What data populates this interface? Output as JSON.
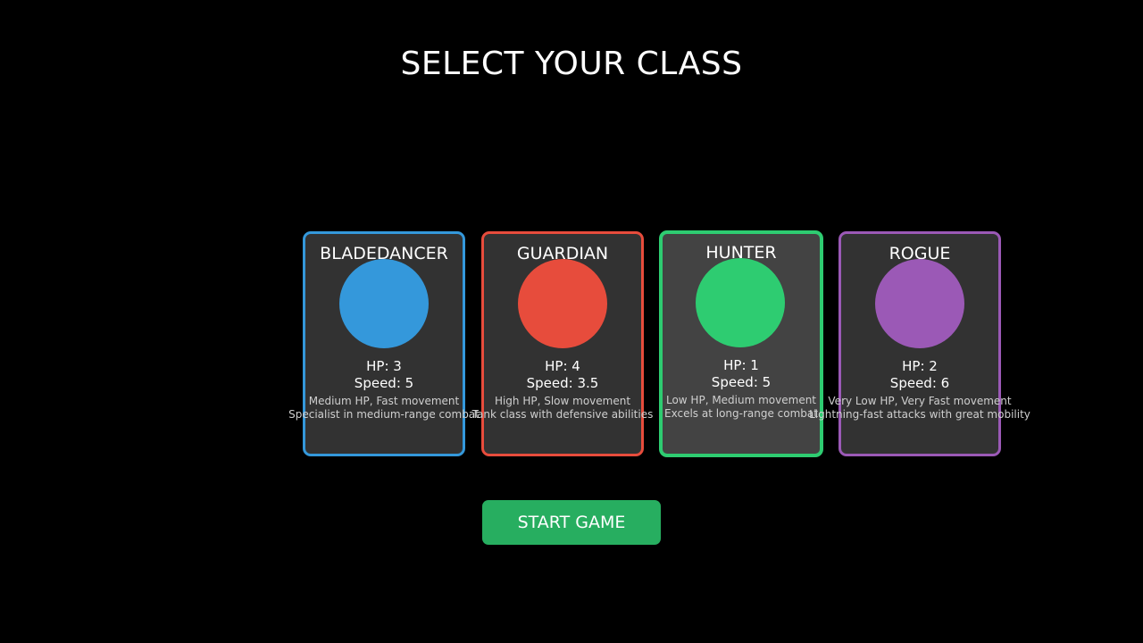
{
  "title": "SELECT YOUR CLASS",
  "selected_class": "HUNTER",
  "classes": [
    {
      "name": "BLADEDANCER",
      "color": "#3498db",
      "hp": "HP: 3",
      "speed": "Speed: 5",
      "desc1": "Medium HP, Fast movement",
      "desc2": "Specialist in medium-range combat"
    },
    {
      "name": "GUARDIAN",
      "color": "#e74c3c",
      "hp": "HP: 4",
      "speed": "Speed: 3.5",
      "desc1": "High HP, Slow movement",
      "desc2": "Tank class with defensive abilities"
    },
    {
      "name": "HUNTER",
      "color": "#2ecc71",
      "hp": "HP: 1",
      "speed": "Speed: 5",
      "desc1": "Low HP, Medium movement",
      "desc2": "Excels at long-range combat"
    },
    {
      "name": "ROGUE",
      "color": "#9b59b6",
      "hp": "HP: 2",
      "speed": "Speed: 6",
      "desc1": "Very Low HP, Very Fast movement",
      "desc2": "Lightning-fast attacks with great mobility"
    }
  ],
  "start_button": {
    "label": "START GAME",
    "color": "#27ae60"
  }
}
